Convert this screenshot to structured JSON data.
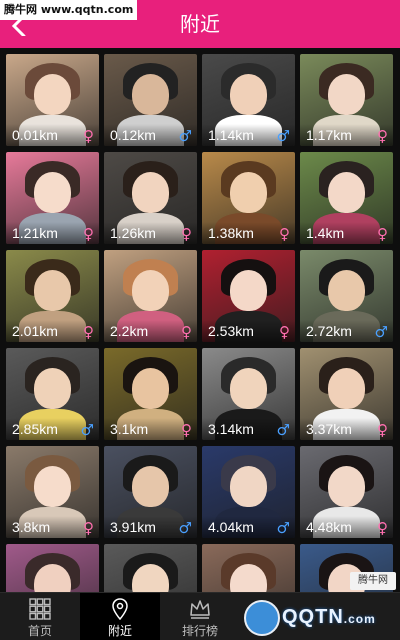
{
  "header": {
    "title": "附近",
    "watermark": "腾牛网 www.qqtn.com",
    "colors": {
      "header_bg": "#e8207c"
    }
  },
  "grid": {
    "tiles": [
      {
        "distance": "0.01km",
        "gender": "♀",
        "gender_type": "female",
        "bg": "#c9a88a",
        "skin": "#f3d6c0",
        "hair": "#6b4a3a",
        "cloth": "#e9e3dc"
      },
      {
        "distance": "0.12km",
        "gender": "♂",
        "gender_type": "male",
        "bg": "#6a5a4a",
        "skin": "#d9b79a",
        "hair": "#222222",
        "cloth": "#cfcfcf"
      },
      {
        "distance": "1.14km",
        "gender": "♂",
        "gender_type": "male",
        "bg": "#4a4a4a",
        "skin": "#f0d0b8",
        "hair": "#2b2b2b",
        "cloth": "#ffffff"
      },
      {
        "distance": "1.17km",
        "gender": "♀",
        "gender_type": "female",
        "bg": "#7a8a5a",
        "skin": "#f2d7c6",
        "hair": "#3b2a22",
        "cloth": "#e0d8c8"
      },
      {
        "distance": "1.21km",
        "gender": "♀",
        "gender_type": "female",
        "bg": "#e77a9a",
        "skin": "#f6dccb",
        "hair": "#3a2a26",
        "cloth": "#9aa4b0"
      },
      {
        "distance": "1.26km",
        "gender": "♀",
        "gender_type": "female",
        "bg": "#4e4a46",
        "skin": "#f1d4bf",
        "hair": "#2a201a",
        "cloth": "#d8d0c8"
      },
      {
        "distance": "1.38km",
        "gender": "♀",
        "gender_type": "female",
        "bg": "#b98a4a",
        "skin": "#f0cfae",
        "hair": "#5a3a20",
        "cloth": "#7a4a2a"
      },
      {
        "distance": "1.4km",
        "gender": "♀",
        "gender_type": "female",
        "bg": "#6c8a4a",
        "skin": "#f3d8c8",
        "hair": "#2a2220",
        "cloth": "#b04060"
      },
      {
        "distance": "2.01km",
        "gender": "♀",
        "gender_type": "female",
        "bg": "#8a8a4a",
        "skin": "#e8c8aa",
        "hair": "#3a2a1a",
        "cloth": "#c0a080"
      },
      {
        "distance": "2.2km",
        "gender": "♀",
        "gender_type": "female",
        "bg": "#c0a080",
        "skin": "#f2d2b8",
        "hair": "#c08050",
        "cloth": "#d06080"
      },
      {
        "distance": "2.53km",
        "gender": "♀",
        "gender_type": "female",
        "bg": "#b02030",
        "skin": "#f4d8c8",
        "hair": "#151010",
        "cloth": "#202020"
      },
      {
        "distance": "2.72km",
        "gender": "♂",
        "gender_type": "male",
        "bg": "#7a8a6a",
        "skin": "#e8c8aa",
        "hair": "#1a1a1a",
        "cloth": "#6a6a5a"
      },
      {
        "distance": "2.85km",
        "gender": "♂",
        "gender_type": "male",
        "bg": "#5a5a5a",
        "skin": "#efd2b8",
        "hair": "#2a2420",
        "cloth": "#e8d060"
      },
      {
        "distance": "3.1km",
        "gender": "♀",
        "gender_type": "female",
        "bg": "#7a6a2a",
        "skin": "#e8c4a0",
        "hair": "#1a1410",
        "cloth": "#d0b080"
      },
      {
        "distance": "3.14km",
        "gender": "♂",
        "gender_type": "male",
        "bg": "#8a8a8a",
        "skin": "#f0d4bc",
        "hair": "#2a2a2a",
        "cloth": "#1a1a1a"
      },
      {
        "distance": "3.37km",
        "gender": "♀",
        "gender_type": "female",
        "bg": "#a09070",
        "skin": "#f0d0b8",
        "hair": "#2a201a",
        "cloth": "#f2f2f2"
      },
      {
        "distance": "3.8km",
        "gender": "♀",
        "gender_type": "female",
        "bg": "#8a7a6a",
        "skin": "#f6dccb",
        "hair": "#7a5a40",
        "cloth": "#d8c8b8"
      },
      {
        "distance": "3.91km",
        "gender": "♂",
        "gender_type": "male",
        "bg": "#4a5060",
        "skin": "#e6c6aa",
        "hair": "#1a1a1a",
        "cloth": "#3a3a3a"
      },
      {
        "distance": "4.04km",
        "gender": "♂",
        "gender_type": "male",
        "bg": "#2a3a6a",
        "skin": "#f0d6c4",
        "hair": "#3a3a4a",
        "cloth": "#202840"
      },
      {
        "distance": "4.48km",
        "gender": "♀",
        "gender_type": "female",
        "bg": "#6a6a70",
        "skin": "#f2d8c8",
        "hair": "#1a1414",
        "cloth": "#e8e8e8"
      },
      {
        "distance": "",
        "gender": "",
        "gender_type": "female",
        "bg": "#a05a8a",
        "skin": "#f0d0c0",
        "hair": "#3a2a2a",
        "cloth": "#e06090"
      },
      {
        "distance": "",
        "gender": "",
        "gender_type": "female",
        "bg": "#5a5a5a",
        "skin": "#f0d6c0",
        "hair": "#1a1a1a",
        "cloth": "#2a2a2a"
      },
      {
        "distance": "",
        "gender": "",
        "gender_type": "female",
        "bg": "#8a6a5a",
        "skin": "#f4dacc",
        "hair": "#5a3a2a",
        "cloth": "#c04060"
      },
      {
        "distance": "",
        "gender": "",
        "gender_type": "female",
        "bg": "#3a5a8a",
        "skin": "#f2d6c6",
        "hair": "#1a1414",
        "cloth": "#f0f0f0"
      }
    ]
  },
  "navbar": {
    "items": [
      {
        "label": "首页",
        "icon": "grid-icon"
      },
      {
        "label": "附近",
        "icon": "location-pin-icon"
      },
      {
        "label": "排行榜",
        "icon": "crown-icon"
      }
    ],
    "active_index": 1
  },
  "watermarks": {
    "bottom_logo": "QQTN",
    "bottom_suffix": ".com",
    "corner_stamp": "腾牛网"
  }
}
